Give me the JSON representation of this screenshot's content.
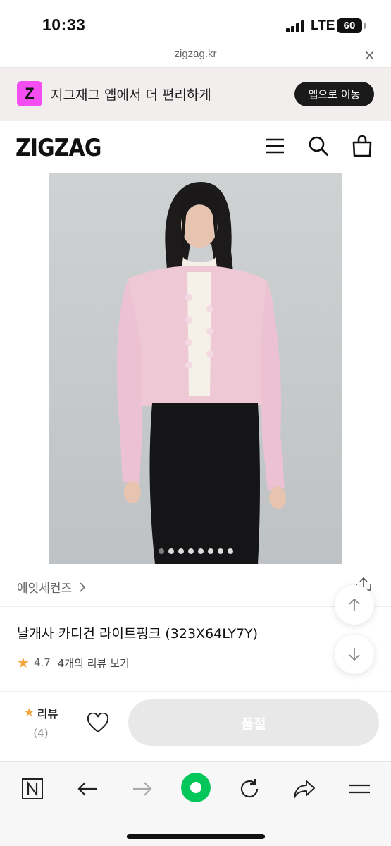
{
  "status_bar": {
    "time": "10:33",
    "network": "LTE",
    "battery": "60"
  },
  "browser": {
    "url": "zigzag.kr",
    "close_symbol": "×"
  },
  "app_banner": {
    "logo_letter": "Z",
    "text": "지그재그 앱에서 더 편리하게",
    "button": "앱으로 이동"
  },
  "header": {
    "brand": "ZIGZAG",
    "icons": [
      "menu-icon",
      "search-icon",
      "shopping-bag-icon"
    ]
  },
  "carousel": {
    "total_images": 8,
    "current_index": 1
  },
  "product": {
    "store": "에잇세컨즈",
    "name": "날개사 카디건 라이트핑크 (323X64LY7Y)",
    "rating": "4.7",
    "review_link": "4개의 리뷰 보기"
  },
  "purchase_bar": {
    "review_label": "리뷰",
    "review_count": "(4)",
    "buy_button": "품절"
  },
  "colors": {
    "brand_pink": "#f44ef2",
    "star": "#f3a43b",
    "naver_green": "#03c75a",
    "soldout_bg": "#e8e8e8"
  }
}
